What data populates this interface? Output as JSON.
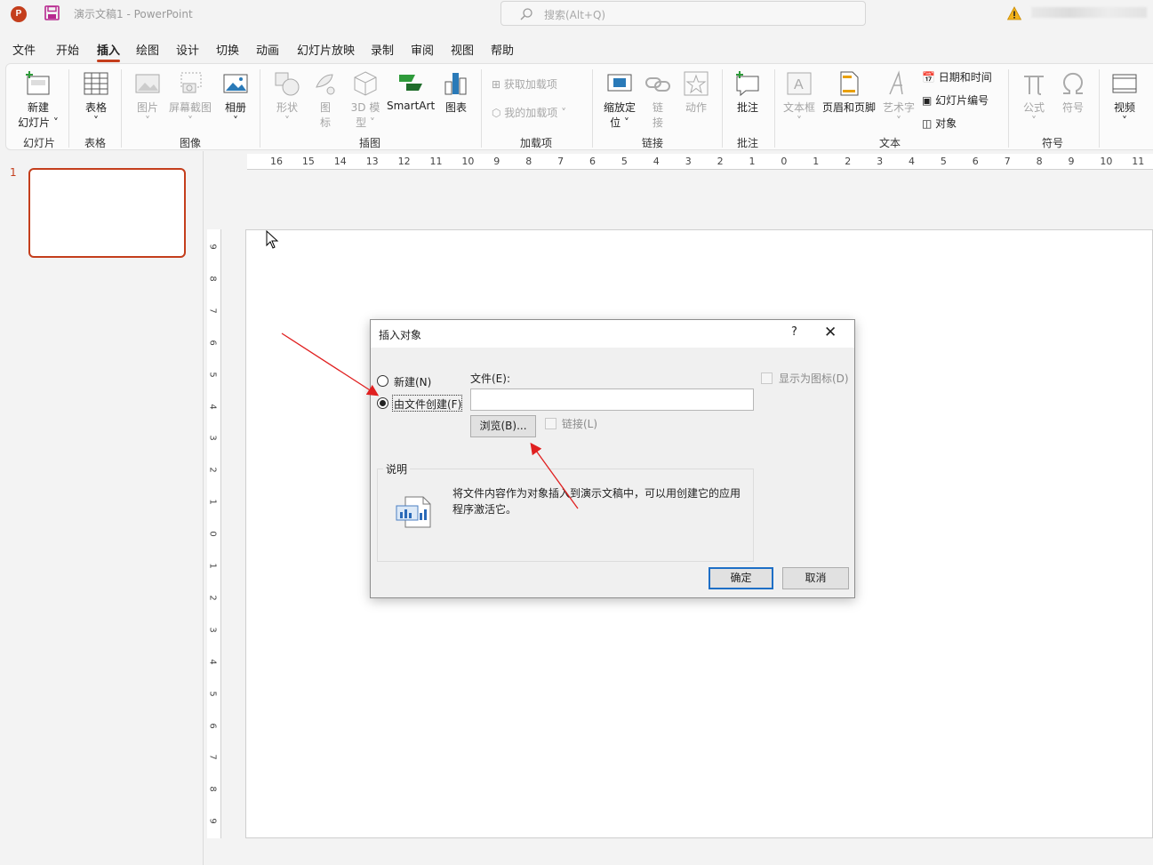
{
  "titlebar": {
    "app_icon": "P",
    "doc_title": "演示文稿1  -  PowerPoint",
    "search_placeholder": "搜索(Alt+Q)"
  },
  "menu_tabs": [
    "文件",
    "开始",
    "插入",
    "绘图",
    "设计",
    "切换",
    "动画",
    "幻灯片放映",
    "录制",
    "审阅",
    "视图",
    "帮助"
  ],
  "active_tab": "插入",
  "ribbon": {
    "new_slide": "新建\n幻灯片",
    "new_slide_line1": "新建",
    "new_slide_line2": "幻灯片 ˅",
    "table": "表格",
    "picture": "图片",
    "screenshot": "屏幕截图",
    "album": "相册",
    "shapes": "形状",
    "icons_line1": "图",
    "icons_line2": "标",
    "model3d_line1": "3D 模",
    "model3d_line2": "型 ˅",
    "smartart": "SmartArt",
    "chart": "图表",
    "get_addins": "获取加载项",
    "my_addins": "我的加载项",
    "zoom_line1": "缩放定",
    "zoom_line2": "位 ˅",
    "link_line1": "链",
    "link_line2": "接",
    "action": "动作",
    "comment": "批注",
    "textbox": "文本框",
    "header_footer": "页眉和页脚",
    "wordart": "艺术字",
    "date_time": "日期和时间",
    "slide_number": "幻灯片编号",
    "object": "对象",
    "equation": "公式",
    "symbol": "符号",
    "video": "视频",
    "groups": {
      "slides": "幻灯片",
      "tables": "表格",
      "images": "图像",
      "illustrations": "插图",
      "addins": "加载项",
      "links": "链接",
      "comments": "批注",
      "text": "文本",
      "symbols": "符号"
    }
  },
  "slide_panel": {
    "slide_number": "1"
  },
  "ruler_h": [
    "16",
    "15",
    "14",
    "13",
    "12",
    "11",
    "10",
    "9",
    "8",
    "7",
    "6",
    "5",
    "4",
    "3",
    "2",
    "1",
    "0",
    "1",
    "2",
    "3",
    "4",
    "5",
    "6",
    "7",
    "8",
    "9",
    "10",
    "11"
  ],
  "ruler_v": [
    "9",
    "8",
    "7",
    "6",
    "5",
    "4",
    "3",
    "2",
    "1",
    "0",
    "1",
    "2",
    "3",
    "4",
    "5",
    "6",
    "7",
    "8",
    "9"
  ],
  "dialog": {
    "title": "插入对象",
    "help": "?",
    "close": "✕",
    "radio_new": "新建(N)",
    "radio_from_file": "由文件创建(F)",
    "file_label": "文件(E):",
    "file_value": "",
    "browse": "浏览(B)...",
    "link": "链接(L)",
    "display_as_icon": "显示为图标(D)",
    "description_title": "说明",
    "description": "将文件内容作为对象插入到演示文稿中，可以用创建它的应用程序激活它。",
    "ok": "确定",
    "cancel": "取消"
  },
  "colors": {
    "accent": "#c43e1c",
    "annotation_arrow": "#e02020",
    "ok_border": "#1e6fc6"
  }
}
